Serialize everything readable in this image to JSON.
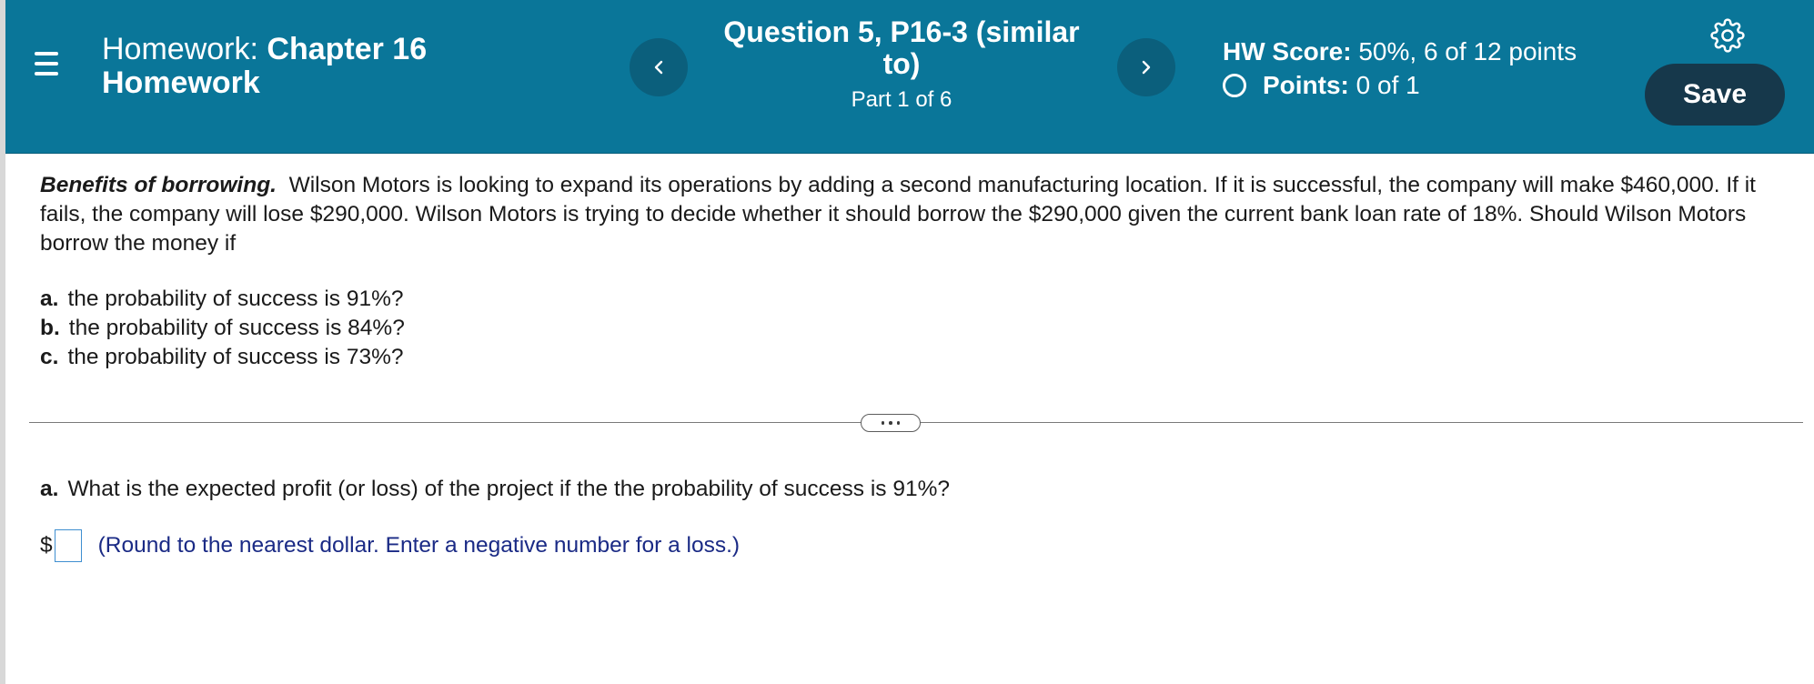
{
  "header": {
    "homework_prefix": "Homework:",
    "homework_name_part1": "Chapter 16",
    "homework_name_part2": "Homework",
    "question_title": "Question 5, P16-3 (similar to)",
    "part_label": "Part 1 of 6",
    "hw_score_label": "HW Score:",
    "hw_score_value": "50%, 6 of 12 points",
    "points_label": "Points:",
    "points_value": "0 of 1",
    "save_label": "Save",
    "prev_glyph": "<",
    "next_glyph": ">"
  },
  "problem": {
    "topic": "Benefits of borrowing.",
    "text": "Wilson Motors is looking to expand its operations by adding a second manufacturing location.  If it is successful, the company will make $460,000.  If it fails, the company will lose $290,000.  Wilson Motors is trying to decide whether it should borrow the $290,000 given the current bank loan rate of 18%.  Should Wilson Motors borrow the money if",
    "options": [
      {
        "letter": "a.",
        "text": "the probability of success is 91%?"
      },
      {
        "letter": "b.",
        "text": "the probability of success is 84%?"
      },
      {
        "letter": "c.",
        "text": "the probability of success is 73%?"
      }
    ]
  },
  "part": {
    "letter": "a.",
    "question": "What is the expected profit (or loss) of the project if the the probability of success is 91%?",
    "currency": "$",
    "answer_value": "",
    "hint": "(Round to the nearest dollar.  Enter a negative number for a loss.)"
  },
  "colors": {
    "header_bg": "#0a7699",
    "nav_button_bg": "#0b5f7c",
    "save_button_bg": "#16384b",
    "hint_text": "#1a2a85",
    "input_border": "#3f8fd0"
  },
  "icons": {
    "menu": "hamburger-menu-icon",
    "settings": "gear-icon",
    "previous": "chevron-left-icon",
    "next": "chevron-right-icon",
    "points_status": "empty-circle-icon",
    "more": "ellipsis-icon"
  }
}
